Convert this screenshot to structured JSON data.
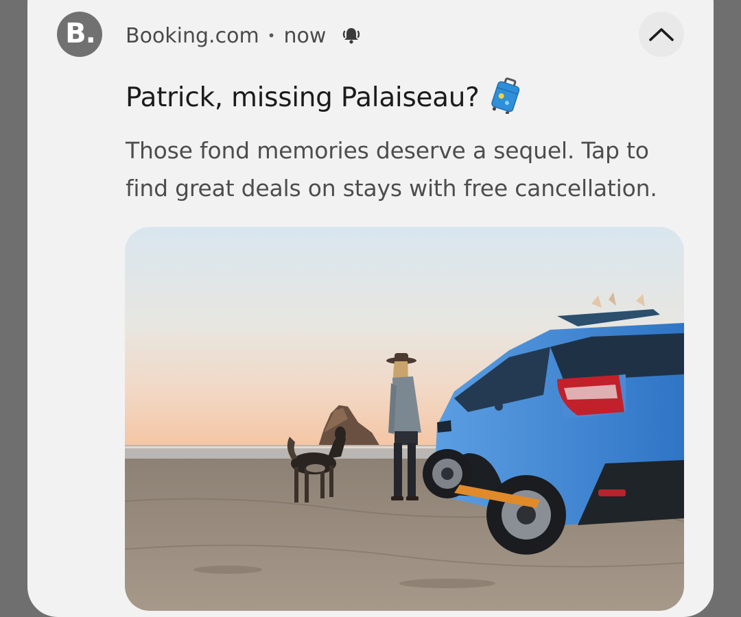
{
  "notification": {
    "app_icon_letter": "B.",
    "app_name": "Booking.com",
    "separator": "•",
    "time": "now",
    "alert_icon": "bell-ringing-icon",
    "collapse_icon": "chevron-up-icon",
    "title": "Patrick, missing Palaiseau?",
    "title_emoji_icon": "suitcase-icon",
    "body": "Those fond memories deserve a sequel. Tap to find great deals on stays with free cancellation.",
    "image": "beach-car-dog-photo"
  },
  "colors": {
    "background": "#6f6f6f",
    "card": "#f2f2f2",
    "app_icon": "#717171",
    "car_blue": "#3d86d4"
  }
}
